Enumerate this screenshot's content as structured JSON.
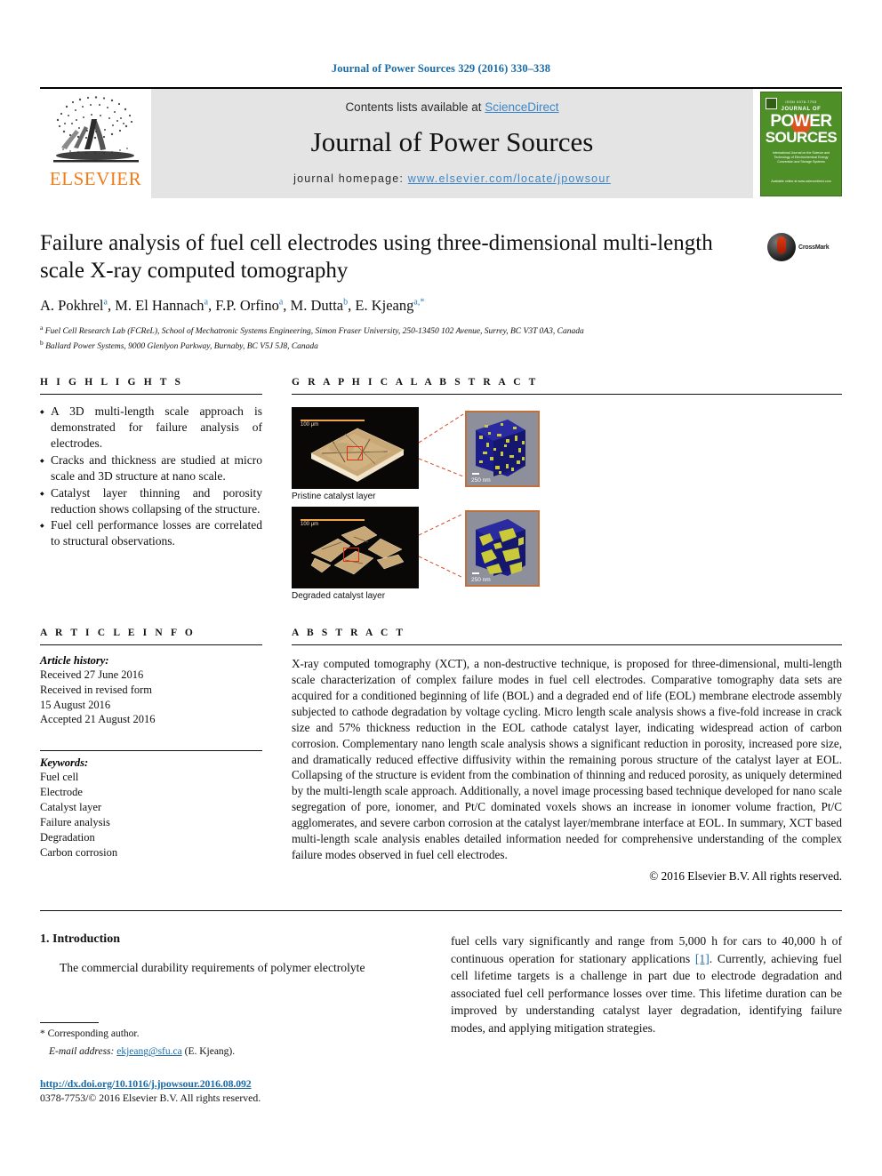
{
  "running_head": "Journal of Power Sources 329 (2016) 330–338",
  "masthead": {
    "publisher_name": "ELSEVIER",
    "contents_prefix": "Contents lists available at ",
    "contents_link": "ScienceDirect",
    "journal_title": "Journal of Power Sources",
    "homepage_prefix": "journal homepage: ",
    "homepage_url": "www.elsevier.com/locate/jpowsour",
    "cover": {
      "top_label": "ISSN 0378-7753",
      "journal_of": "JOURNAL OF",
      "power": "POWER",
      "sources": "SOURCES",
      "subtitle": "International Journal on the Science and Technology of Electrochemical Energy Conversion and Storage Systems",
      "bottom": "Available online at www.sciencedirect.com"
    }
  },
  "article": {
    "title": "Failure analysis of fuel cell electrodes using three-dimensional multi-length scale X-ray computed tomography",
    "crossmark_label": "CrossMark",
    "authors": [
      {
        "name": "A. Pokhrel",
        "marks": "a"
      },
      {
        "name": "M. El Hannach",
        "marks": "a"
      },
      {
        "name": "F.P. Orfino",
        "marks": "a"
      },
      {
        "name": "M. Dutta",
        "marks": "b"
      },
      {
        "name": "E. Kjeang",
        "marks": "a,",
        "star": "*"
      }
    ],
    "affiliations": [
      {
        "mark": "a",
        "text": "Fuel Cell Research Lab (FCReL), School of Mechatronic Systems Engineering, Simon Fraser University, 250-13450 102 Avenue, Surrey, BC V3T 0A3, Canada"
      },
      {
        "mark": "b",
        "text": "Ballard Power Systems, 9000 Glenlyon Parkway, Burnaby, BC V5J 5J8, Canada"
      }
    ]
  },
  "highlights": {
    "heading": "H I G H L I G H T S",
    "items": [
      "A 3D multi-length scale approach is demonstrated for failure analysis of electrodes.",
      "Cracks and thickness are studied at micro scale and 3D structure at nano scale.",
      "Catalyst layer thinning and porosity reduction shows collapsing of the structure.",
      "Fuel cell performance losses are correlated to structural observations."
    ]
  },
  "graphical_abstract": {
    "heading": "G R A P H I C A L   A B S T R A C T",
    "figures": [
      {
        "caption": "Pristine catalyst layer",
        "micro_scale": "100 μm",
        "nano_scale": "250 nm"
      },
      {
        "caption": "Degraded catalyst layer",
        "micro_scale": "100 μm",
        "nano_scale": "250 nm"
      }
    ]
  },
  "article_info": {
    "heading": "A R T I C L E   I N F O",
    "history_label": "Article history:",
    "history": [
      "Received 27 June 2016",
      "Received in revised form",
      "15 August 2016",
      "Accepted 21 August 2016"
    ],
    "keywords_label": "Keywords:",
    "keywords": [
      "Fuel cell",
      "Electrode",
      "Catalyst layer",
      "Failure analysis",
      "Degradation",
      "Carbon corrosion"
    ]
  },
  "abstract": {
    "heading": "A B S T R A C T",
    "text": "X-ray computed tomography (XCT), a non-destructive technique, is proposed for three-dimensional, multi-length scale characterization of complex failure modes in fuel cell electrodes. Comparative tomography data sets are acquired for a conditioned beginning of life (BOL) and a degraded end of life (EOL) membrane electrode assembly subjected to cathode degradation by voltage cycling. Micro length scale analysis shows a five-fold increase in crack size and 57% thickness reduction in the EOL cathode catalyst layer, indicating widespread action of carbon corrosion. Complementary nano length scale analysis shows a significant reduction in porosity, increased pore size, and dramatically reduced effective diffusivity within the remaining porous structure of the catalyst layer at EOL. Collapsing of the structure is evident from the combination of thinning and reduced porosity, as uniquely determined by the multi-length scale approach. Additionally, a novel image processing based technique developed for nano scale segregation of pore, ionomer, and Pt/C dominated voxels shows an increase in ionomer volume fraction, Pt/C agglomerates, and severe carbon corrosion at the catalyst layer/membrane interface at EOL. In summary, XCT based multi-length scale analysis enables detailed information needed for comprehensive understanding of the complex failure modes observed in fuel cell electrodes.",
    "copyright": "© 2016 Elsevier B.V. All rights reserved."
  },
  "body": {
    "section_number": "1.",
    "section_title": "Introduction",
    "left_paragraph": "The commercial durability requirements of polymer electrolyte",
    "right_paragraph_pre": "fuel cells vary significantly and range from 5,000 h for cars to 40,000 h of continuous operation for stationary applications ",
    "right_citation": "[1]",
    "right_paragraph_post": ". Currently, achieving fuel cell lifetime targets is a challenge in part due to electrode degradation and associated fuel cell performance losses over time. This lifetime duration can be improved by understanding catalyst layer degradation, identifying failure modes, and applying mitigation strategies."
  },
  "footnote": {
    "corresponding": "* Corresponding author.",
    "email_label": "E-mail address:",
    "email": "ekjeang@sfu.ca",
    "email_suffix": "(E. Kjeang)."
  },
  "doi": {
    "url": "http://dx.doi.org/10.1016/j.jpowsour.2016.08.092",
    "issn_line": "0378-7753/© 2016 Elsevier B.V. All rights reserved."
  },
  "colors": {
    "link_blue": "#1a6ca8",
    "sd_blue": "#3b87c9",
    "elsevier_orange": "#f07c19",
    "cover_green": "#4f8f27",
    "crossmark_red": "#d22f0e"
  }
}
